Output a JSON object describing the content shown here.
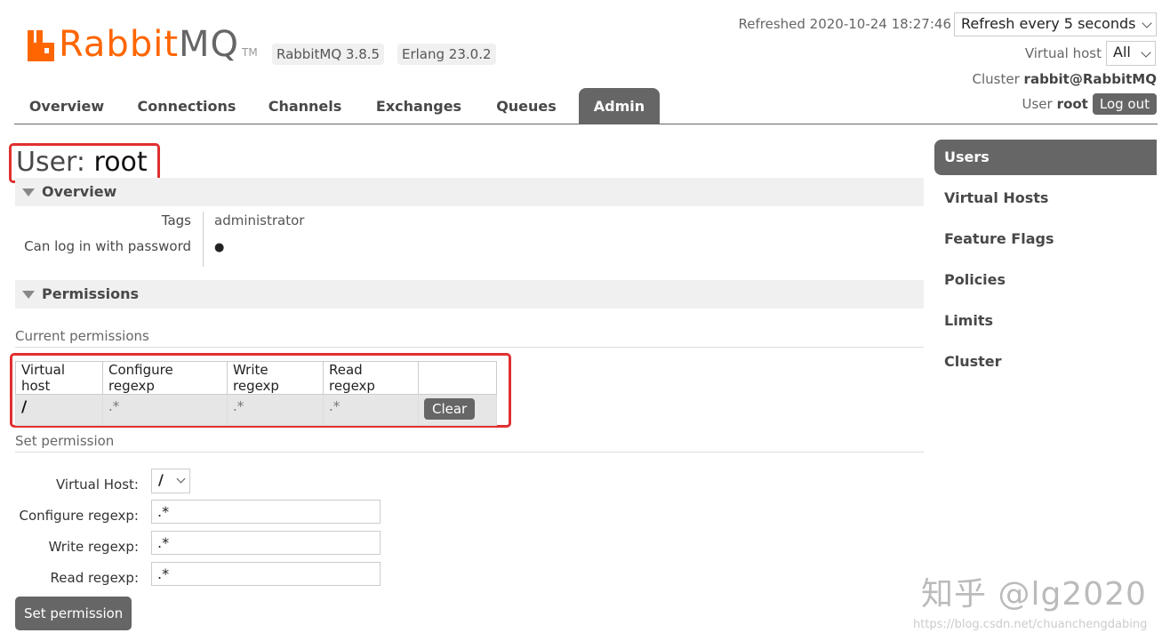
{
  "brand": {
    "name_part1": "Rabbit",
    "name_part2": "MQ",
    "tm": "TM",
    "brand_color": "#ff6600"
  },
  "versions": {
    "rabbitmq": "RabbitMQ 3.8.5",
    "erlang": "Erlang 23.0.2"
  },
  "header": {
    "refreshed": "Refreshed 2020-10-24 18:27:46",
    "refresh_select": "Refresh every 5 seconds",
    "vhost_label": "Virtual host",
    "vhost_select": "All",
    "cluster_label": "Cluster",
    "cluster_name": "rabbit@RabbitMQ",
    "user_label": "User",
    "user_name": "root",
    "logout": "Log out"
  },
  "tabs": [
    {
      "label": "Overview"
    },
    {
      "label": "Connections"
    },
    {
      "label": "Channels"
    },
    {
      "label": "Exchanges"
    },
    {
      "label": "Queues"
    },
    {
      "label": "Admin",
      "active": true
    }
  ],
  "sidebar": [
    {
      "label": "Users",
      "active": true
    },
    {
      "label": "Virtual Hosts"
    },
    {
      "label": "Feature Flags"
    },
    {
      "label": "Policies"
    },
    {
      "label": "Limits"
    },
    {
      "label": "Cluster"
    }
  ],
  "page": {
    "title_prefix": "User:",
    "title_user": "root"
  },
  "overview": {
    "heading": "Overview",
    "tags_label": "Tags",
    "tags_value": "administrator",
    "login_label": "Can log in with password",
    "login_value": "●"
  },
  "permissions": {
    "heading": "Permissions",
    "current_label": "Current permissions",
    "columns": [
      "Virtual host",
      "Configure regexp",
      "Write regexp",
      "Read regexp"
    ],
    "rows": [
      {
        "vhost": "/",
        "configure": ".*",
        "write": ".*",
        "read": ".*",
        "action": "Clear"
      }
    ]
  },
  "set_permission": {
    "heading": "Set permission",
    "vhost_label": "Virtual Host:",
    "vhost_value": "/",
    "configure_label": "Configure regexp:",
    "configure_value": ".*",
    "write_label": "Write regexp:",
    "write_value": ".*",
    "read_label": "Read regexp:",
    "read_value": ".*",
    "submit": "Set permission"
  },
  "watermark": {
    "text": "知乎 @lg2020",
    "url": "https://blog.csdn.net/chuanchengdabing"
  },
  "colors": {
    "highlight_red": "#e03030",
    "tab_active": "#666666"
  }
}
